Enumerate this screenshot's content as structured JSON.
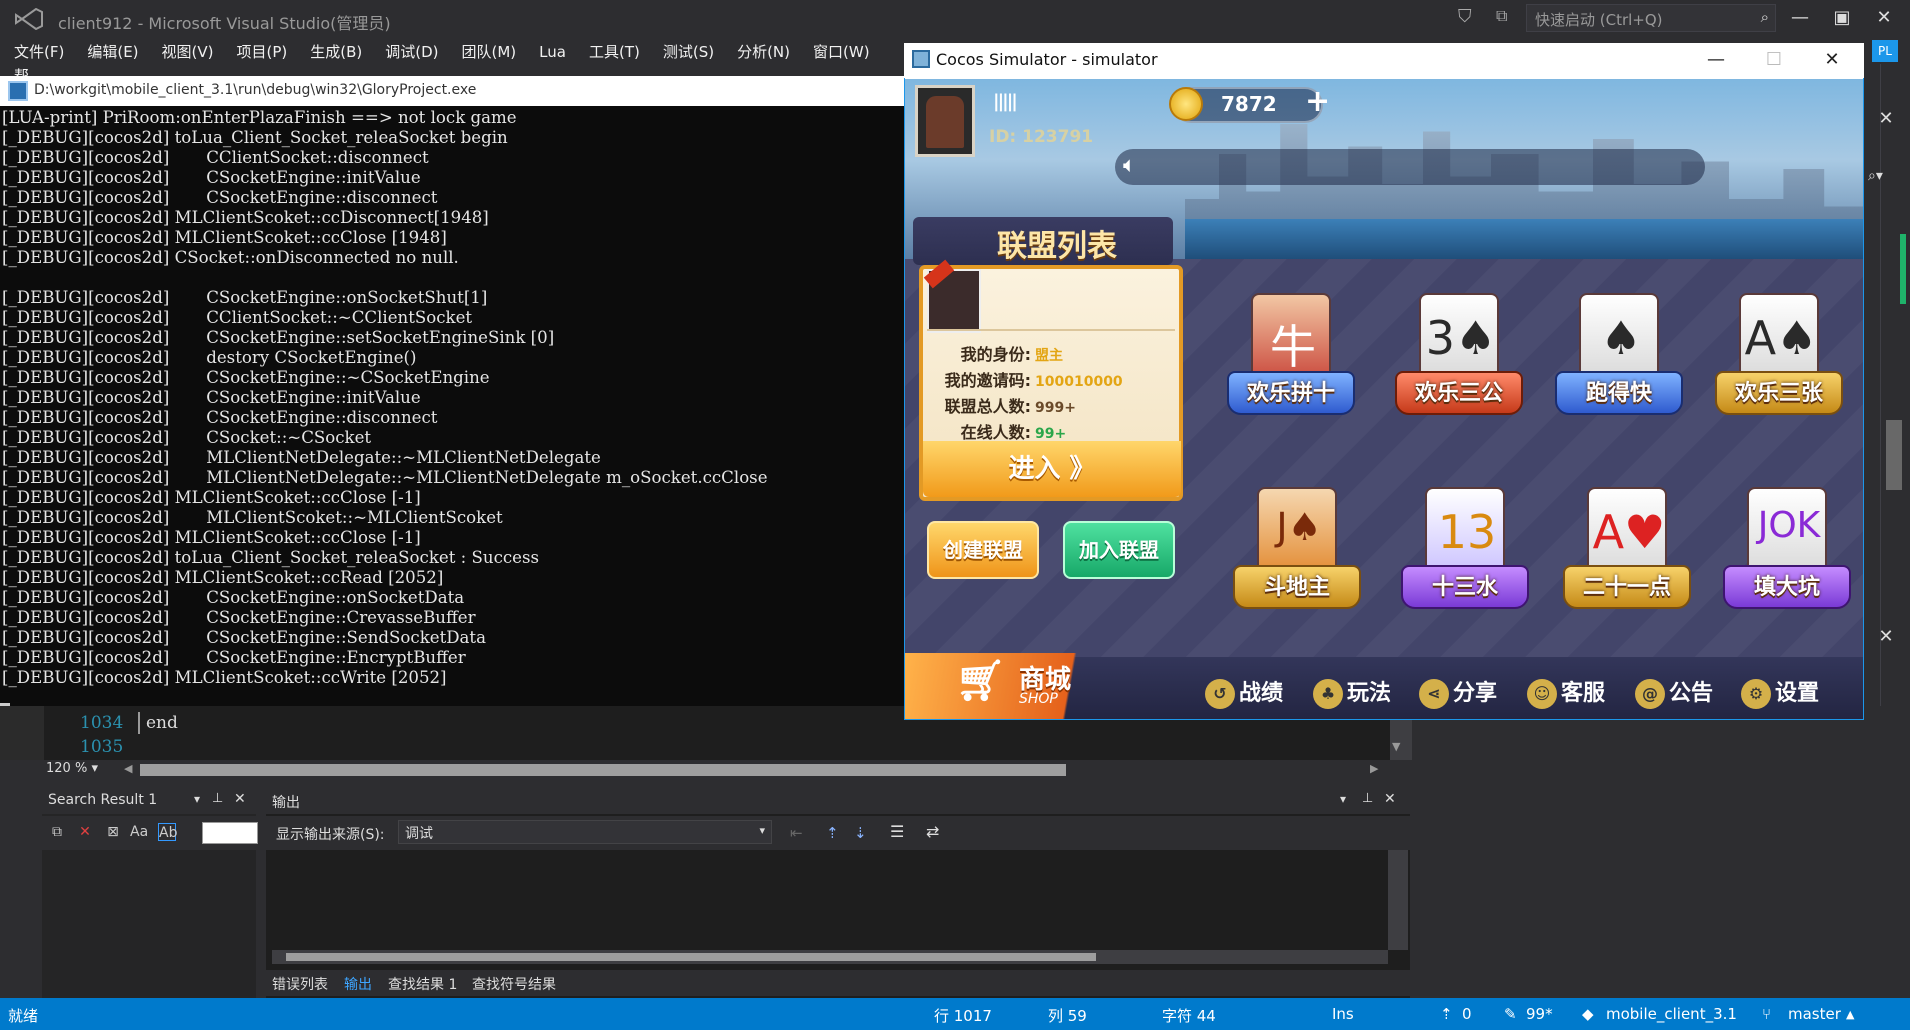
{
  "vs": {
    "title": "client912 - Microsoft Visual Studio(管理员)",
    "quick_launch_placeholder": "快速启动 (Ctrl+Q)",
    "menu": [
      "文件(F)",
      "编辑(E)",
      "视图(V)",
      "项目(P)",
      "生成(B)",
      "调试(D)",
      "团队(M)",
      "Lua",
      "工具(T)",
      "测试(S)",
      "分析(N)",
      "窗口(W)",
      "帮"
    ],
    "account_badge": "PL"
  },
  "console": {
    "title": "D:\\workgit\\mobile_client_3.1\\run\\debug\\win32\\GloryProject.exe",
    "lines": [
      "[LUA-print] PriRoom:onEnterPlazaFinish ==> not lock game",
      "[_DEBUG][cocos2d] toLua_Client_Socket_releaSocket begin",
      "[_DEBUG][cocos2d]       CClientSocket::disconnect",
      "[_DEBUG][cocos2d]       CSocketEngine::initValue",
      "[_DEBUG][cocos2d]       CSocketEngine::disconnect",
      "[_DEBUG][cocos2d] MLClientScoket::ccDisconnect[1948]",
      "[_DEBUG][cocos2d] MLClientScoket::ccClose [1948]",
      "[_DEBUG][cocos2d] CSocket::onDisconnected no null.",
      "",
      "[_DEBUG][cocos2d]       CSocketEngine::onSocketShut[1]",
      "[_DEBUG][cocos2d]       CClientSocket::~CClientSocket",
      "[_DEBUG][cocos2d]       CSocketEngine::setSocketEngineSink [0]",
      "[_DEBUG][cocos2d]       destory CSocketEngine()",
      "[_DEBUG][cocos2d]       CSocketEngine::~CSocketEngine",
      "[_DEBUG][cocos2d]       CSocketEngine::initValue",
      "[_DEBUG][cocos2d]       CSocketEngine::disconnect",
      "[_DEBUG][cocos2d]       CSocket::~CSocket",
      "[_DEBUG][cocos2d]       MLClientNetDelegate::~MLClientNetDelegate",
      "[_DEBUG][cocos2d]       MLClientNetDelegate::~MLClientNetDelegate m_oSocket.ccClose",
      "[_DEBUG][cocos2d] MLClientScoket::ccClose [-1]",
      "[_DEBUG][cocos2d]       MLClientScoket::~MLClientScoket",
      "[_DEBUG][cocos2d] MLClientScoket::ccClose [-1]",
      "[_DEBUG][cocos2d] toLua_Client_Socket_releaSocket : Success",
      "[_DEBUG][cocos2d] MLClientScoket::ccRead [2052]",
      "[_DEBUG][cocos2d]       CSocketEngine::onSocketData",
      "[_DEBUG][cocos2d]       CSocketEngine::CrevasseBuffer",
      "[_DEBUG][cocos2d]       CSocketEngine::SendSocketData",
      "[_DEBUG][cocos2d]       CSocketEngine::EncryptBuffer",
      "[_DEBUG][cocos2d] MLClientScoket::ccWrite [2052]"
    ]
  },
  "editor": {
    "line1": "1034",
    "line2": "1035",
    "code": "end",
    "zoom": "120 %"
  },
  "search_panel": {
    "title": "Search Result 1"
  },
  "output_panel": {
    "title": "输出",
    "source_label": "显示输出来源(S):",
    "source_value": "调试"
  },
  "bottom_tabs": [
    "错误列表",
    "输出",
    "查找结果 1",
    "查找符号结果"
  ],
  "status": {
    "ready": "就绪",
    "row": "行 1017",
    "col": "列 59",
    "char": "字符 44",
    "ins": "Ins",
    "up_count": "0",
    "edits": "99*",
    "repo": "mobile_client_3.1",
    "branch": "master"
  },
  "simulator": {
    "title": "Cocos Simulator - simulator",
    "player": {
      "bars": "|||||",
      "id": "ID: 123791"
    },
    "coins": "7872",
    "league_title": "联盟列表",
    "league": {
      "identity_label": "我的身份:",
      "identity_value": "盟主",
      "invite_label": "我的邀请码:",
      "invite_value": "100010000",
      "total_label": "联盟总人数:",
      "total_value": "999+",
      "online_label": "在线人数:",
      "online_value": "99+",
      "enter": "进入 》"
    },
    "create_button": "创建联盟",
    "join_button": "加入联盟",
    "games": [
      "欢乐拼十",
      "欢乐三公",
      "跑得快",
      "欢乐三张",
      "斗地主",
      "十三水",
      "二十一点",
      "填大坑"
    ],
    "shop": {
      "label": "商城",
      "sub": "SHOP"
    },
    "nav": [
      "战绩",
      "玩法",
      "分享",
      "客服",
      "公告",
      "设置"
    ]
  },
  "colors": {
    "vs_bg": "#2d2d30",
    "status_blue": "#007acc",
    "console_bg": "#0c0c0c",
    "gold": "#f19a1a",
    "green": "#17a868"
  }
}
